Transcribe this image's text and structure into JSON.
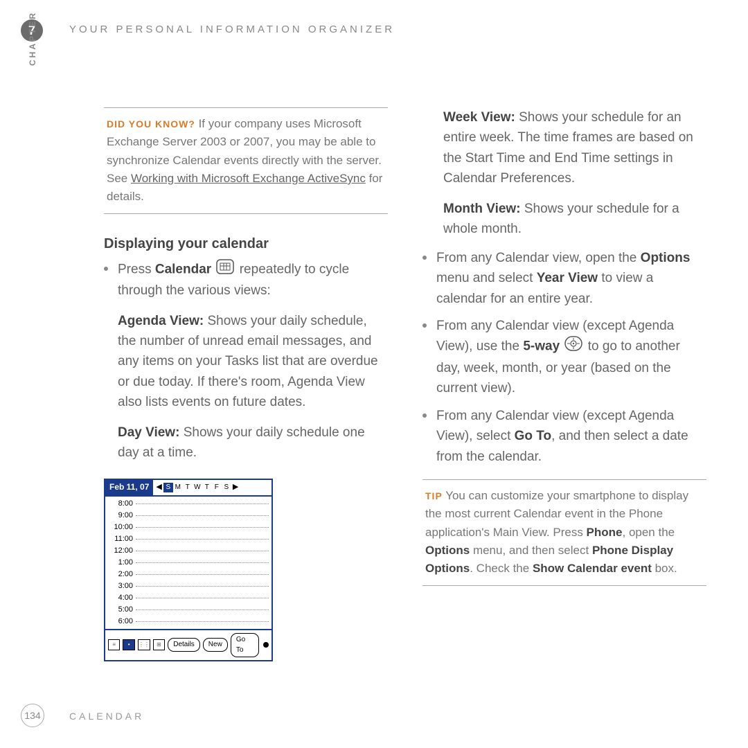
{
  "header": {
    "chapter_number": "7",
    "title": "YOUR PERSONAL INFORMATION ORGANIZER",
    "side_label": "CHAPTER"
  },
  "left": {
    "dyk": {
      "label": "DID YOU KNOW?",
      "text_1": " If your company uses Microsoft Exchange Server 2003 or 2007, you may be able to synchronize Calendar events directly with the server. See ",
      "link": "Working with Microsoft Exchange ActiveSync",
      "text_2": " for details."
    },
    "section_title": "Displaying your calendar",
    "press_1": "Press ",
    "press_bold": "Calendar",
    "press_2": " repeatedly to cycle through the various views:",
    "agenda_bold": "Agenda View:",
    "agenda_text": " Shows your daily schedule, the number of unread email messages, and any items on your Tasks list that are overdue or due today. If there's room, Agenda View also lists events on future dates.",
    "day_bold": "Day View:",
    "day_text": " Shows your daily schedule one day at a time."
  },
  "screenshot": {
    "date": "Feb 11, 07",
    "days": [
      "S",
      "M",
      "T",
      "W",
      "T",
      "F",
      "S"
    ],
    "times": [
      "8:00",
      "9:00",
      "10:00",
      "11:00",
      "12:00",
      "1:00",
      "2:00",
      "3:00",
      "4:00",
      "5:00",
      "6:00"
    ],
    "btn_details": "Details",
    "btn_new": "New",
    "btn_goto": "Go To"
  },
  "right": {
    "week_bold": "Week View:",
    "week_text": " Shows your schedule for an entire week. The time frames are based on the Start Time and End Time settings in Calendar Preferences.",
    "month_bold": "Month View:",
    "month_text": " Shows your schedule for a whole month.",
    "year_1": "From any Calendar view, open the ",
    "year_b1": "Options",
    "year_2": " menu and select ",
    "year_b2": "Year View",
    "year_3": " to view a calendar for an entire year.",
    "nav_1": "From any Calendar view (except Agenda View), use the ",
    "nav_b1": "5-way",
    "nav_2": " to go to another day, week, month, or year (based on the current view).",
    "goto_1": "From any Calendar view (except Agenda View), select ",
    "goto_b1": "Go To",
    "goto_2": ", and then select a date from the calendar.",
    "tip": {
      "label": "TIP",
      "t1": " You can customize your smartphone to display the most current Calendar event in the Phone application's Main View. Press ",
      "b1": "Phone",
      "t2": ", open the ",
      "b2": "Options",
      "t3": " menu, and then select ",
      "b3": "Phone Display Options",
      "t4": ". Check the ",
      "b4": "Show Calendar event",
      "t5": " box."
    }
  },
  "footer": {
    "page": "134",
    "label": "CALENDAR"
  }
}
